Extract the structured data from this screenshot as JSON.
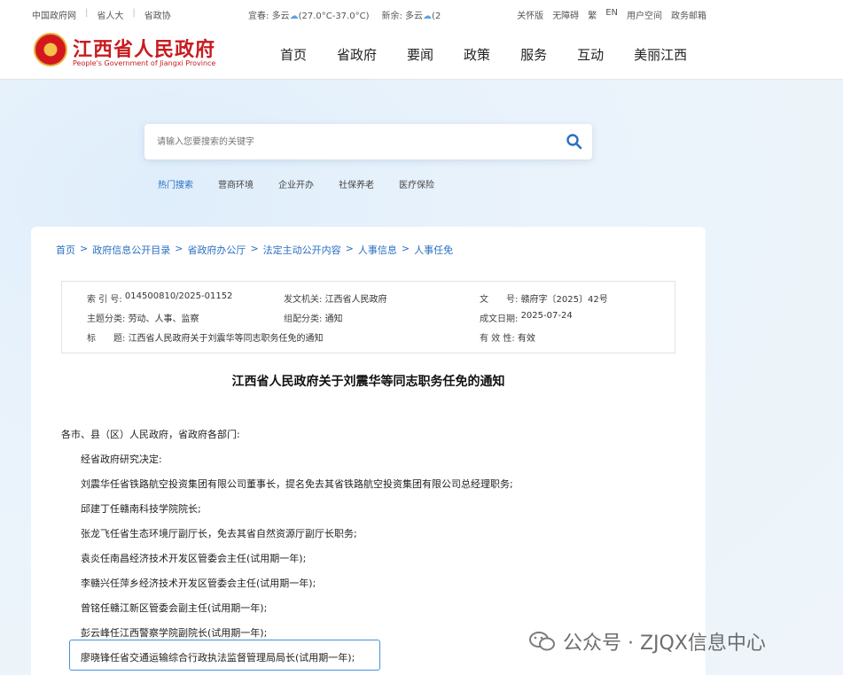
{
  "topbar": {
    "links": [
      "中国政府网",
      "省人大",
      "省政协"
    ],
    "weather": [
      {
        "city": "宜春:",
        "cond": "多云",
        "temp": "(27.0°C-37.0°C)"
      },
      {
        "city": "新余:",
        "cond": "多云",
        "temp": "(2"
      }
    ],
    "right": [
      "关怀版",
      "无障碍",
      "繁",
      "EN",
      "用户空间",
      "政务邮箱"
    ]
  },
  "header": {
    "logo_cn": "江西省人民政府",
    "logo_en": "People's Government of Jiangxi Province",
    "nav": [
      "首页",
      "省政府",
      "要闻",
      "政策",
      "服务",
      "互动",
      "美丽江西"
    ]
  },
  "search": {
    "placeholder": "请输入您要搜索的关键字",
    "hot": [
      "热门搜索",
      "营商环境",
      "企业开办",
      "社保养老",
      "医疗保险"
    ]
  },
  "breadcrumb": [
    "首页",
    "政府信息公开目录",
    "省政府办公厅",
    "法定主动公开内容",
    "人事信息",
    "人事任免"
  ],
  "meta": {
    "index_k": "索 引 号:",
    "index_v": "014500810/2025-01152",
    "org_k": "发文机关:",
    "org_v": "江西省人民政府",
    "doc_k": "文　　号:",
    "doc_v": "赣府字〔2025〕42号",
    "topic_k": "主题分类:",
    "topic_v": "劳动、人事、监察",
    "cat_k": "组配分类:",
    "cat_v": "通知",
    "date_k": "成文日期:",
    "date_v": "2025-07-24",
    "title_k": "标　　题:",
    "title_v": "江西省人民政府关于刘震华等同志职务任免的通知",
    "valid_k": "有 效 性:",
    "valid_v": "有效"
  },
  "article": {
    "title": "江西省人民政府关于刘震华等同志职务任免的通知",
    "salutation": "各市、县（区）人民政府，省政府各部门:",
    "lines": [
      "经省政府研究决定:",
      "刘震华任省铁路航空投资集团有限公司董事长，提名免去其省铁路航空投资集团有限公司总经理职务;",
      "邱建丁任赣南科技学院院长;",
      "张龙飞任省生态环境厅副厅长，免去其省自然资源厅副厅长职务;",
      "袁炎任南昌经济技术开发区管委会主任(试用期一年);",
      "李赣兴任萍乡经济技术开发区管委会主任(试用期一年);",
      "曾铭任赣江新区管委会副主任(试用期一年);",
      "彭云峰任江西警察学院副院长(试用期一年);",
      "廖晓锋任省交通运输综合行政执法监督管理局局长(试用期一年);"
    ]
  },
  "watermark": {
    "text": "公众号 · ZJQX信息中心"
  },
  "colors": {
    "brand_red": "#c81b20",
    "link_blue": "#2a6fc2"
  }
}
